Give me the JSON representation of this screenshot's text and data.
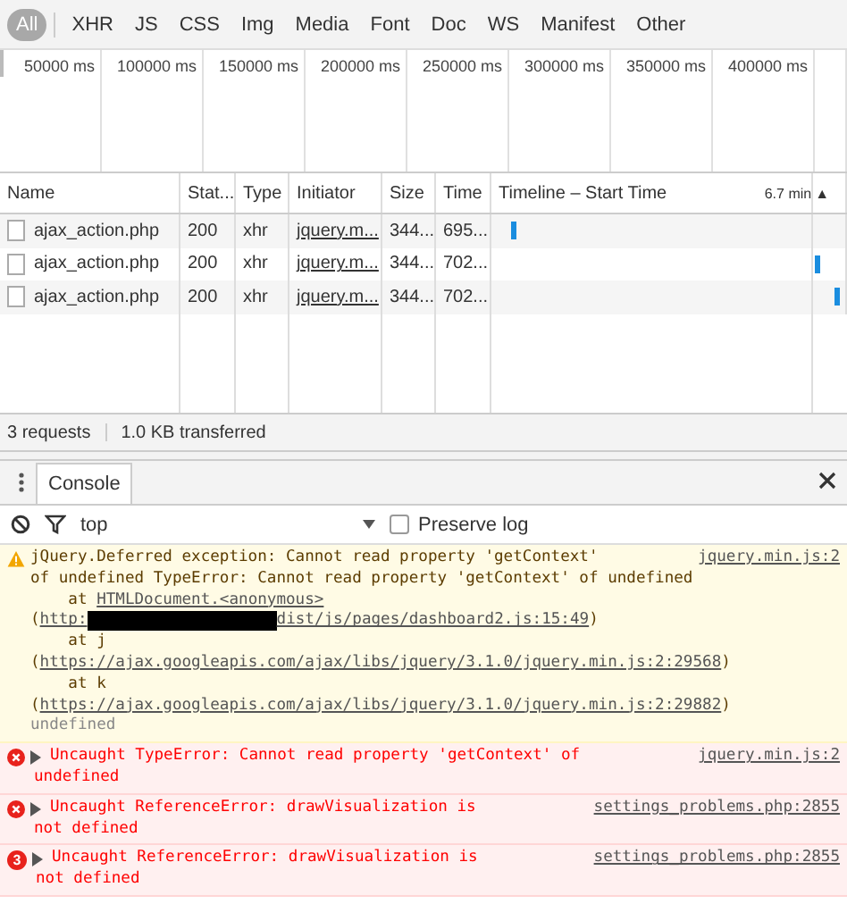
{
  "filters": [
    {
      "label": "All",
      "selected": true
    },
    {
      "label": "XHR",
      "selected": false
    },
    {
      "label": "JS",
      "selected": false
    },
    {
      "label": "CSS",
      "selected": false
    },
    {
      "label": "Img",
      "selected": false
    },
    {
      "label": "Media",
      "selected": false
    },
    {
      "label": "Font",
      "selected": false
    },
    {
      "label": "Doc",
      "selected": false
    },
    {
      "label": "WS",
      "selected": false
    },
    {
      "label": "Manifest",
      "selected": false
    },
    {
      "label": "Other",
      "selected": false
    }
  ],
  "overview": {
    "ticks": [
      "50000 ms",
      "100000 ms",
      "150000 ms",
      "200000 ms",
      "250000 ms",
      "300000 ms",
      "350000 ms",
      "400000 ms"
    ]
  },
  "table": {
    "columns": [
      "Name",
      "Stat...",
      "Type",
      "Initiator",
      "Size",
      "Time",
      "Timeline – Start Time"
    ],
    "timeline_scale": "6.7 min",
    "sort_arrow": "▲",
    "rows": [
      {
        "name": "ajax_action.php",
        "status": "200",
        "type": "xhr",
        "initiator": "jquery.m...",
        "size": "344...",
        "time": "695..."
      },
      {
        "name": "ajax_action.php",
        "status": "200",
        "type": "xhr",
        "initiator": "jquery.m...",
        "size": "344...",
        "time": "702..."
      },
      {
        "name": "ajax_action.php",
        "status": "200",
        "type": "xhr",
        "initiator": "jquery.m...",
        "size": "344...",
        "time": "702..."
      }
    ]
  },
  "summary": [
    "3 requests",
    "1.0 KB transferred"
  ],
  "drawer": {
    "tabs": [
      {
        "label": "Console",
        "selected": true
      }
    ]
  },
  "console_toolbar": {
    "context": "top",
    "preserve_log": {
      "label": "Preserve log",
      "checked": false
    }
  },
  "messages": [
    {
      "kind": "warning",
      "source": "jquery.min.js:2",
      "lines": [
        [
          {
            "kind": "plain",
            "text": "jQuery.Deferred exception: Cannot read property 'getContext'"
          }
        ],
        [
          {
            "kind": "plain",
            "text": "of undefined TypeError: Cannot read property 'getContext' of undefined"
          }
        ],
        [
          {
            "kind": "plain",
            "text": "    at "
          },
          {
            "kind": "link",
            "text": "HTMLDocument.<anonymous>"
          }
        ],
        [
          {
            "kind": "plain",
            "text": "("
          },
          {
            "kind": "link",
            "text": "http:"
          },
          {
            "kind": "redacted"
          },
          {
            "kind": "link",
            "text": "dist/js/pages/dashboard2.js:15:49"
          },
          {
            "kind": "plain",
            "text": ")"
          }
        ],
        [
          {
            "kind": "plain",
            "text": "    at j"
          }
        ],
        [
          {
            "kind": "plain",
            "text": "("
          },
          {
            "kind": "link",
            "text": "https://ajax.googleapis.com/ajax/libs/jquery/3.1.0/jquery.min.js:2:29568"
          },
          {
            "kind": "plain",
            "text": ")"
          }
        ],
        [
          {
            "kind": "plain",
            "text": "    at k"
          }
        ],
        [
          {
            "kind": "plain",
            "text": "("
          },
          {
            "kind": "link",
            "text": "https://ajax.googleapis.com/ajax/libs/jquery/3.1.0/jquery.min.js:2:29882"
          },
          {
            "kind": "plain",
            "text": ")"
          }
        ],
        [
          {
            "kind": "muted",
            "text": "undefined"
          }
        ]
      ]
    },
    {
      "kind": "error",
      "source": "jquery.min.js:2",
      "lines": [
        [
          {
            "kind": "plain",
            "text": "Uncaught TypeError: Cannot read property 'getContext' of"
          }
        ],
        [
          {
            "kind": "plain",
            "text": "undefined"
          }
        ]
      ]
    },
    {
      "kind": "error",
      "source": "settings_problems.php:2855",
      "lines": [
        [
          {
            "kind": "plain",
            "text": "Uncaught ReferenceError: drawVisualization is"
          }
        ],
        [
          {
            "kind": "plain",
            "text": "not defined"
          }
        ]
      ]
    },
    {
      "kind": "error",
      "count": "3",
      "source": "settings_problems.php:2855",
      "lines": [
        [
          {
            "kind": "plain",
            "text": "Uncaught ReferenceError: drawVisualization is"
          }
        ],
        [
          {
            "kind": "plain",
            "text": "not defined"
          }
        ]
      ]
    }
  ]
}
